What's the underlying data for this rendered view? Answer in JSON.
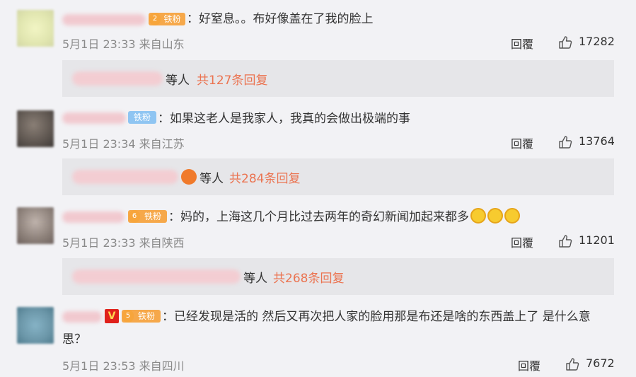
{
  "comments": [
    {
      "badge": "铁粉",
      "badge_level": "2",
      "text": "：好窒息。。布好像盖在了我的脸上",
      "meta": "5月1日 23:33 来自山东",
      "reply_label": "回覆",
      "likes": "17282",
      "replies_who": "等人",
      "replies_count": "共127条回复"
    },
    {
      "badge": "铁粉",
      "text": "：如果这老人是我家人，我真的会做出极端的事",
      "meta": "5月1日 23:34 来自江苏",
      "reply_label": "回覆",
      "likes": "13764",
      "replies_who": "等人",
      "replies_count": "共284条回复"
    },
    {
      "badge": "铁粉",
      "badge_level": "6",
      "text": "：妈的，上海这几个月比过去两年的奇幻新闻加起来都多",
      "meta": "5月1日 23:33 来自陕西",
      "reply_label": "回覆",
      "likes": "11201",
      "replies_who": "等人",
      "replies_count": "共268条回复"
    },
    {
      "vip": "V",
      "badge": "铁粉",
      "badge_level": "5",
      "text_line1": "：已经发现是活的 然后又再次把人家的脸用那是布还是啥的东西盖上了 是什么意",
      "text_line2": "思？",
      "meta": "5月1日 23:53 来自四川",
      "reply_label": "回覆",
      "likes": "7672"
    }
  ],
  "colors": {
    "background": "#f2f2f5",
    "reply_box": "#e6e6e9",
    "reply_count": "#eb7350",
    "meta": "#8a8a8a",
    "badge_orange": "#f6a84a",
    "badge_blue": "#8fc5f2"
  },
  "icons": [
    "thumbs-up-icon",
    "smile-emoji-icon",
    "fire-badge-icon",
    "vip-icon"
  ]
}
